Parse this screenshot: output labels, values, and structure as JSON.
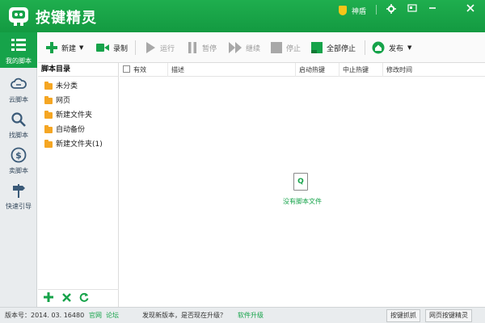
{
  "app": {
    "title": "按键精灵",
    "shield_label": "神盾"
  },
  "window_controls": {
    "settings_icon": "gear-icon",
    "restore_icon": "window-icon",
    "minimize_icon": "minimize-icon",
    "close_icon": "close-icon"
  },
  "leftnav": {
    "items": [
      {
        "label": "我的脚本",
        "icon": "list-icon"
      },
      {
        "label": "云脚本",
        "icon": "cloud-icon"
      },
      {
        "label": "找脚本",
        "icon": "search-icon"
      },
      {
        "label": "卖脚本",
        "icon": "dollar-icon"
      },
      {
        "label": "快速引导",
        "icon": "signpost-icon"
      }
    ]
  },
  "toolbar": {
    "new_label": "新建",
    "record_label": "录制",
    "run_label": "运行",
    "pause_label": "暂停",
    "continue_label": "继续",
    "stop_label": "停止",
    "stop_all_label": "全部停止",
    "publish_label": "发布"
  },
  "directory": {
    "header": "脚本目录",
    "folders": [
      "未分类",
      "网页",
      "新建文件夹",
      "自动备份",
      "新建文件夹(1)"
    ]
  },
  "list": {
    "columns": [
      "有效",
      "描述",
      "启动热键",
      "中止热键",
      "修改时间"
    ],
    "empty_icon_letter": "Q",
    "empty_message": "没有脚本文件"
  },
  "statusbar": {
    "version": "版本号：2014. 03. 16480",
    "official_site": "官网",
    "forum": "论坛",
    "update_prompt": "发现新版本，是否现在升级？",
    "upgrade_link": "软件升级",
    "capture_button": "按键抓抓",
    "web_button": "网页按键精灵"
  },
  "colors": {
    "brand_green": "#16a34a",
    "folder_orange": "#f5a623",
    "shield_yellow": "#f5c518"
  }
}
